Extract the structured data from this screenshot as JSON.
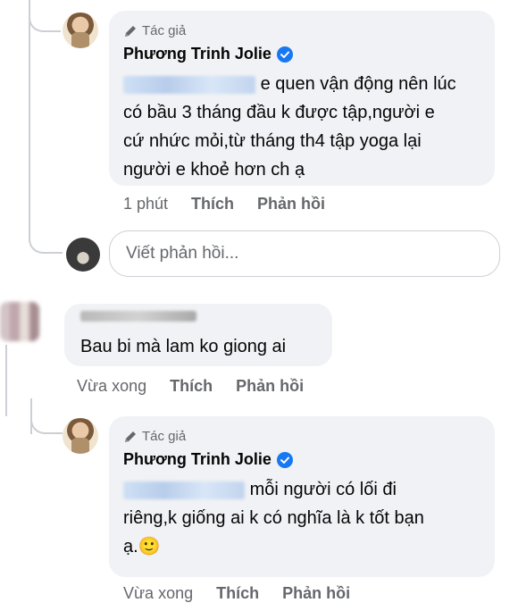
{
  "comment1": {
    "badge": "Tác giả",
    "author": "Phương Trinh Jolie",
    "text_line1": "e quen vận động nên lúc",
    "text_line2": "có bầu 3 tháng đầu k được tập,người e",
    "text_line3": "cứ nhức mỏi,từ tháng th4 tập yoga lại",
    "text_line4": "người e khoẻ hơn ch ạ",
    "time": "1 phút",
    "like": "Thích",
    "reply": "Phản hồi"
  },
  "reply_box": {
    "placeholder": "Viết phản hồi..."
  },
  "comment2": {
    "text": "Bau bi mà lam ko giong ai",
    "time": "Vừa xong",
    "like": "Thích",
    "reply": "Phản hồi"
  },
  "comment3": {
    "badge": "Tác giả",
    "author": "Phương Trinh Jolie",
    "text_line1": "mỗi người có lối đi",
    "text_line2": "riêng,k giống ai k có nghĩa là k tốt bạn",
    "text_line3": "ạ.🙂",
    "time": "Vừa xong",
    "like": "Thích",
    "reply": "Phản hồi"
  },
  "colors": {
    "bubble": "#f0f2f5",
    "secondary_text": "#65676b",
    "verified_blue": "#1877f2"
  }
}
